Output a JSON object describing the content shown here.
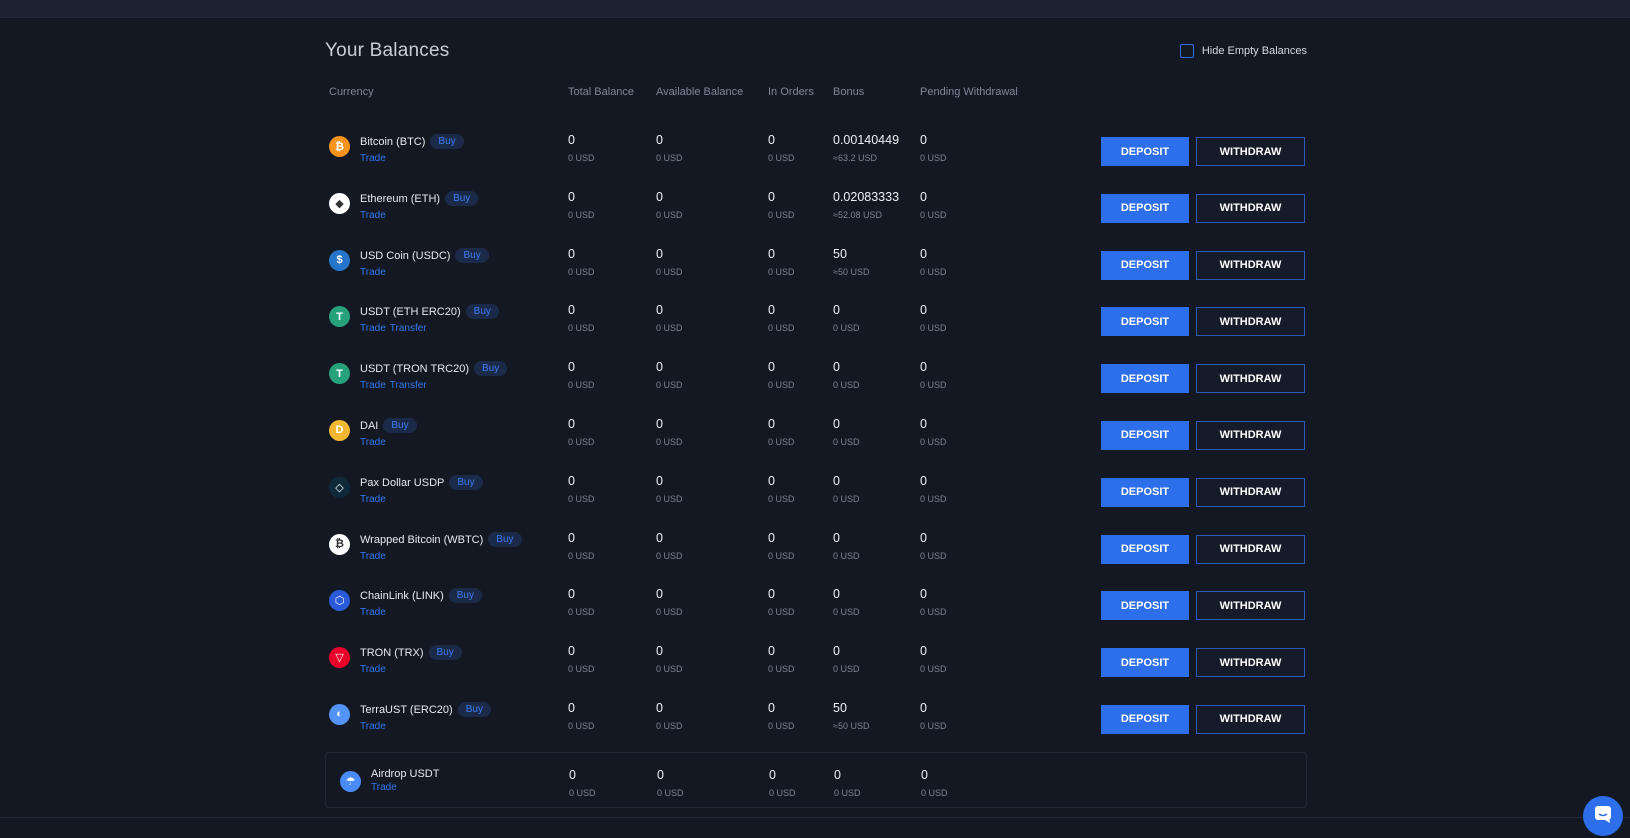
{
  "page": {
    "title": "Your Balances",
    "hide_empty_label": "Hide Empty Balances"
  },
  "columns": {
    "currency": "Currency",
    "total": "Total Balance",
    "available": "Available Balance",
    "orders": "In Orders",
    "bonus": "Bonus",
    "pending": "Pending Withdrawal"
  },
  "buttons": {
    "deposit": "DEPOSIT",
    "withdraw": "WITHDRAW",
    "buy": "Buy"
  },
  "rows": [
    {
      "icon": "bitcoin-icon",
      "color": "#f7931a",
      "glyph": "₿",
      "name": "Bitcoin (BTC)",
      "links": [
        "Trade"
      ],
      "total": "0",
      "total_usd": "0 USD",
      "available": "0",
      "available_usd": "0 USD",
      "orders": "0",
      "orders_usd": "0 USD",
      "bonus": "0.00140449",
      "bonus_usd": "≈63.2 USD",
      "pending": "0",
      "pending_usd": "0 USD"
    },
    {
      "icon": "ethereum-icon",
      "color": "#ffffff",
      "glyph": "◆",
      "name": "Ethereum (ETH)",
      "links": [
        "Trade"
      ],
      "total": "0",
      "total_usd": "0 USD",
      "available": "0",
      "available_usd": "0 USD",
      "orders": "0",
      "orders_usd": "0 USD",
      "bonus": "0.02083333",
      "bonus_usd": "≈52.08 USD",
      "pending": "0",
      "pending_usd": "0 USD"
    },
    {
      "icon": "usd-coin-icon",
      "color": "#2775ca",
      "glyph": "$",
      "name": "USD Coin (USDC)",
      "links": [
        "Trade"
      ],
      "total": "0",
      "total_usd": "0 USD",
      "available": "0",
      "available_usd": "0 USD",
      "orders": "0",
      "orders_usd": "0 USD",
      "bonus": "50",
      "bonus_usd": "≈50 USD",
      "pending": "0",
      "pending_usd": "0 USD"
    },
    {
      "icon": "tether-icon",
      "color": "#26a17b",
      "glyph": "T",
      "name": "USDT (ETH ERC20)",
      "links": [
        "Trade",
        "Transfer"
      ],
      "total": "0",
      "total_usd": "0 USD",
      "available": "0",
      "available_usd": "0 USD",
      "orders": "0",
      "orders_usd": "0 USD",
      "bonus": "0",
      "bonus_usd": "0 USD",
      "pending": "0",
      "pending_usd": "0 USD"
    },
    {
      "icon": "tether-tron-icon",
      "color": "#26a17b",
      "glyph": "T",
      "name": "USDT (TRON TRC20)",
      "links": [
        "Trade",
        "Transfer"
      ],
      "total": "0",
      "total_usd": "0 USD",
      "available": "0",
      "available_usd": "0 USD",
      "orders": "0",
      "orders_usd": "0 USD",
      "bonus": "0",
      "bonus_usd": "0 USD",
      "pending": "0",
      "pending_usd": "0 USD"
    },
    {
      "icon": "dai-icon",
      "color": "#f4b731",
      "glyph": "D",
      "name": "DAI",
      "links": [
        "Trade"
      ],
      "total": "0",
      "total_usd": "0 USD",
      "available": "0",
      "available_usd": "0 USD",
      "orders": "0",
      "orders_usd": "0 USD",
      "bonus": "0",
      "bonus_usd": "0 USD",
      "pending": "0",
      "pending_usd": "0 USD"
    },
    {
      "icon": "pax-dollar-icon",
      "color": "#0e2a3a",
      "glyph": "◇",
      "name": "Pax Dollar USDP",
      "links": [
        "Trade"
      ],
      "total": "0",
      "total_usd": "0 USD",
      "available": "0",
      "available_usd": "0 USD",
      "orders": "0",
      "orders_usd": "0 USD",
      "bonus": "0",
      "bonus_usd": "0 USD",
      "pending": "0",
      "pending_usd": "0 USD"
    },
    {
      "icon": "wrapped-bitcoin-icon",
      "color": "#ffffff",
      "glyph": "₿",
      "name": "Wrapped Bitcoin (WBTC)",
      "links": [
        "Trade"
      ],
      "total": "0",
      "total_usd": "0 USD",
      "available": "0",
      "available_usd": "0 USD",
      "orders": "0",
      "orders_usd": "0 USD",
      "bonus": "0",
      "bonus_usd": "0 USD",
      "pending": "0",
      "pending_usd": "0 USD"
    },
    {
      "icon": "chainlink-icon",
      "color": "#2a5ada",
      "glyph": "⬡",
      "name": "ChainLink (LINK)",
      "links": [
        "Trade"
      ],
      "total": "0",
      "total_usd": "0 USD",
      "available": "0",
      "available_usd": "0 USD",
      "orders": "0",
      "orders_usd": "0 USD",
      "bonus": "0",
      "bonus_usd": "0 USD",
      "pending": "0",
      "pending_usd": "0 USD"
    },
    {
      "icon": "tron-icon",
      "color": "#eb0029",
      "glyph": "▽",
      "name": "TRON (TRX)",
      "links": [
        "Trade"
      ],
      "total": "0",
      "total_usd": "0 USD",
      "available": "0",
      "available_usd": "0 USD",
      "orders": "0",
      "orders_usd": "0 USD",
      "bonus": "0",
      "bonus_usd": "0 USD",
      "pending": "0",
      "pending_usd": "0 USD"
    },
    {
      "icon": "terrausd-icon",
      "color": "#5493f7",
      "glyph": "◐",
      "name": "TerraUST (ERC20)",
      "links": [
        "Trade"
      ],
      "total": "0",
      "total_usd": "0 USD",
      "available": "0",
      "available_usd": "0 USD",
      "orders": "0",
      "orders_usd": "0 USD",
      "bonus": "50",
      "bonus_usd": "≈50 USD",
      "pending": "0",
      "pending_usd": "0 USD"
    }
  ],
  "airdrop": {
    "icon": "airdrop-icon",
    "color": "#4a8cf7",
    "glyph": "☂",
    "name": "Airdrop USDT",
    "links": [
      "Trade"
    ],
    "total": "0",
    "total_usd": "0 USD",
    "available": "0",
    "available_usd": "0 USD",
    "orders": "0",
    "orders_usd": "0 USD",
    "bonus": "0",
    "bonus_usd": "0 USD",
    "pending": "0",
    "pending_usd": "0 USD"
  },
  "chat": {
    "icon": "chat-icon",
    "color": "#2d6fea"
  }
}
